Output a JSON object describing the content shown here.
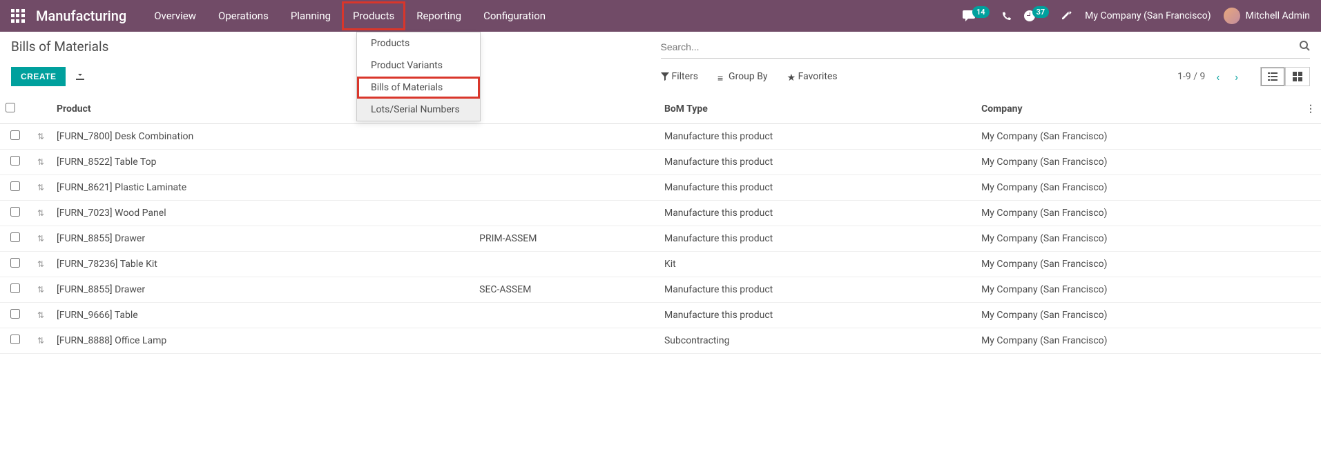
{
  "navbar": {
    "brand": "Manufacturing",
    "items": [
      "Overview",
      "Operations",
      "Planning",
      "Products",
      "Reporting",
      "Configuration"
    ],
    "active_index": 3,
    "chat_badge": "14",
    "activity_badge": "37",
    "company": "My Company (San Francisco)",
    "user": "Mitchell Admin"
  },
  "dropdown": {
    "items": [
      "Products",
      "Product Variants",
      "Bills of Materials",
      "Lots/Serial Numbers"
    ],
    "highlighted_index": 2,
    "hover_index": 3
  },
  "control_panel": {
    "breadcrumb": "Bills of Materials",
    "search_placeholder": "Search...",
    "create_label": "CREATE",
    "filters_label": "Filters",
    "groupby_label": "Group By",
    "favorites_label": "Favorites",
    "pager_text": "1-9 / 9"
  },
  "table": {
    "headers": {
      "product": "Product",
      "reference": "",
      "bom_type": "BoM Type",
      "company": "Company"
    },
    "rows": [
      {
        "product": "[FURN_7800] Desk Combination",
        "reference": "",
        "bom_type": "Manufacture this product",
        "company": "My Company (San Francisco)"
      },
      {
        "product": "[FURN_8522] Table Top",
        "reference": "",
        "bom_type": "Manufacture this product",
        "company": "My Company (San Francisco)"
      },
      {
        "product": "[FURN_8621] Plastic Laminate",
        "reference": "",
        "bom_type": "Manufacture this product",
        "company": "My Company (San Francisco)"
      },
      {
        "product": "[FURN_7023] Wood Panel",
        "reference": "",
        "bom_type": "Manufacture this product",
        "company": "My Company (San Francisco)"
      },
      {
        "product": "[FURN_8855] Drawer",
        "reference": "PRIM-ASSEM",
        "bom_type": "Manufacture this product",
        "company": "My Company (San Francisco)"
      },
      {
        "product": "[FURN_78236] Table Kit",
        "reference": "",
        "bom_type": "Kit",
        "company": "My Company (San Francisco)"
      },
      {
        "product": "[FURN_8855] Drawer",
        "reference": "SEC-ASSEM",
        "bom_type": "Manufacture this product",
        "company": "My Company (San Francisco)"
      },
      {
        "product": "[FURN_9666] Table",
        "reference": "",
        "bom_type": "Manufacture this product",
        "company": "My Company (San Francisco)"
      },
      {
        "product": "[FURN_8888] Office Lamp",
        "reference": "",
        "bom_type": "Subcontracting",
        "company": "My Company (San Francisco)"
      }
    ]
  }
}
